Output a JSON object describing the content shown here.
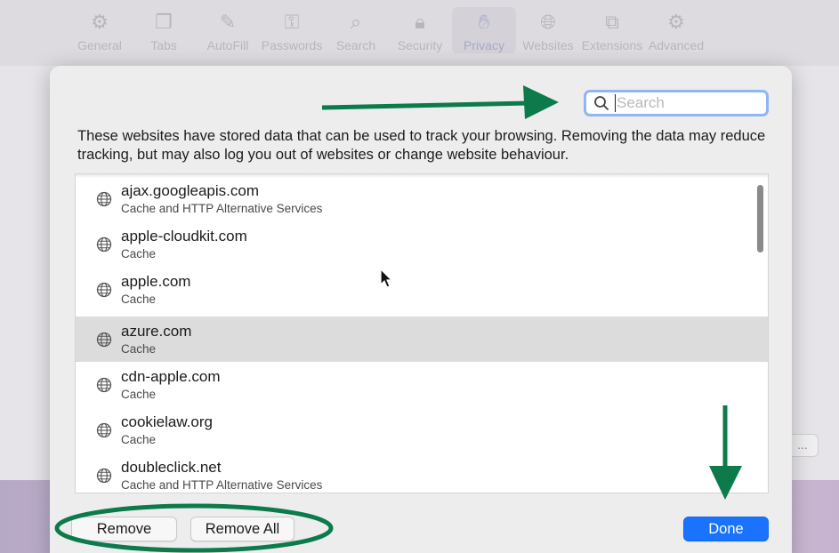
{
  "toolbar": {
    "items": [
      {
        "label": "General",
        "icon": "gear-icon"
      },
      {
        "label": "Tabs",
        "icon": "tabs-icon"
      },
      {
        "label": "AutoFill",
        "icon": "pencil-field-icon"
      },
      {
        "label": "Passwords",
        "icon": "key-icon"
      },
      {
        "label": "Search",
        "icon": "magnifier-icon"
      },
      {
        "label": "Security",
        "icon": "lock-icon"
      },
      {
        "label": "Privacy",
        "icon": "hand-icon"
      },
      {
        "label": "Websites",
        "icon": "globe-icon"
      },
      {
        "label": "Extensions",
        "icon": "puzzle-icon"
      },
      {
        "label": "Advanced",
        "icon": "gears-icon"
      }
    ],
    "active": "Privacy"
  },
  "background": {
    "side_button_label": "..."
  },
  "dialog": {
    "search": {
      "placeholder": "Search",
      "value": ""
    },
    "description": "These websites have stored data that can be used to track your browsing. Removing the data may reduce tracking, but may also log you out of websites or change website behaviour.",
    "websites": [
      {
        "site": "ajax.googleapis.com",
        "type": "Cache and HTTP Alternative Services",
        "selected": false
      },
      {
        "site": "apple-cloudkit.com",
        "type": "Cache",
        "selected": false
      },
      {
        "site": "apple.com",
        "type": "Cache",
        "selected": false
      },
      {
        "site": "azure.com",
        "type": "Cache",
        "selected": true
      },
      {
        "site": "cdn-apple.com",
        "type": "Cache",
        "selected": false
      },
      {
        "site": "cookielaw.org",
        "type": "Cache",
        "selected": false
      },
      {
        "site": "doubleclick.net",
        "type": "Cache and HTTP Alternative Services",
        "selected": false
      }
    ],
    "buttons": {
      "remove": "Remove",
      "remove_all": "Remove All",
      "done": "Done"
    }
  },
  "colors": {
    "accent": "#1a73ff",
    "annotation": "#0c7a4a",
    "selected_row": "#dcdcdc",
    "focus_ring": "#8fb5f5"
  }
}
